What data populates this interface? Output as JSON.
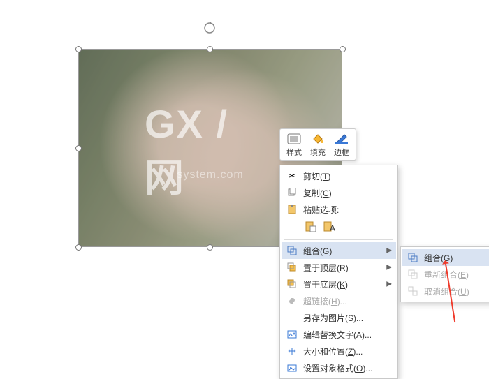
{
  "watermark": {
    "big": "GX / 网",
    "small": "system.com"
  },
  "miniToolbar": {
    "style": "样式",
    "fill": "填充",
    "outline": "边框"
  },
  "menu": {
    "cut": {
      "label": "剪切",
      "accel": "T"
    },
    "copy": {
      "label": "复制",
      "accel": "C"
    },
    "pasteOptions": {
      "label": "粘贴选项:"
    },
    "group": {
      "label": "组合",
      "accel": "G"
    },
    "bringFront": {
      "label": "置于顶层",
      "accel": "R"
    },
    "sendBack": {
      "label": "置于底层",
      "accel": "K"
    },
    "hyperlink": {
      "label": "超链接",
      "accel": "H"
    },
    "savePic": {
      "label": "另存为图片",
      "accel": "S"
    },
    "altText": {
      "label": "编辑替换文字",
      "accel": "A"
    },
    "sizePos": {
      "label": "大小和位置",
      "accel": "Z"
    },
    "formatObj": {
      "label": "设置对象格式",
      "accel": "O"
    }
  },
  "submenu": {
    "group": {
      "label": "组合",
      "accel": "G"
    },
    "regroup": {
      "label": "重新组合",
      "accel": "E"
    },
    "ungroup": {
      "label": "取消组合",
      "accel": "U"
    }
  }
}
